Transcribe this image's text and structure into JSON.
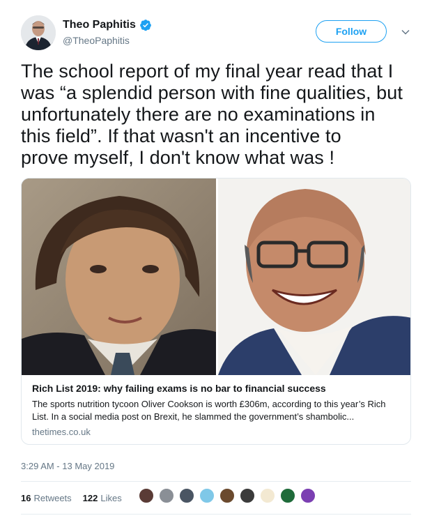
{
  "author": {
    "name": "Theo Paphitis",
    "handle": "@TheoPaphitis",
    "verified": true,
    "avatar_icon": "profile-photo"
  },
  "actions": {
    "follow_label": "Follow",
    "more_icon": "chevron-down-icon"
  },
  "tweet": {
    "text": "The school report of my final year read that I\nwas “a splendid person with fine qualities, but\nunfortunately there are no examinations in\nthis field”.   If that wasn't an incentive to\nprove myself, I don't know what was !"
  },
  "card": {
    "image_left": "childhood-school-photo",
    "image_right": "adult-portrait-photo",
    "title": "Rich List 2019: why failing exams is no bar to financial success",
    "description": "The sports nutrition tycoon Oliver Cookson is worth £306m, according to this year’s Rich List. In a social media post on Brexit, he slammed the government’s shambolic...",
    "domain": "thetimes.co.uk"
  },
  "timestamp": "3:29 AM - 13 May 2019",
  "stats": {
    "retweets_count": "16",
    "retweets_label": "Retweets",
    "likes_count": "122",
    "likes_label": "Likes"
  },
  "likers": [
    {
      "color": "#5a3b36"
    },
    {
      "color": "#8a8f96"
    },
    {
      "color": "#4a5563"
    },
    {
      "color": "#7fc8e8"
    },
    {
      "color": "#6b4a2e"
    },
    {
      "color": "#3b3b3b"
    },
    {
      "color": "#f3e9d2"
    },
    {
      "color": "#1f6b3a"
    },
    {
      "color": "#7b3fb2"
    }
  ],
  "colors": {
    "accent": "#1da1f2",
    "secondary_text": "#657786",
    "border": "#e1e8ed"
  }
}
